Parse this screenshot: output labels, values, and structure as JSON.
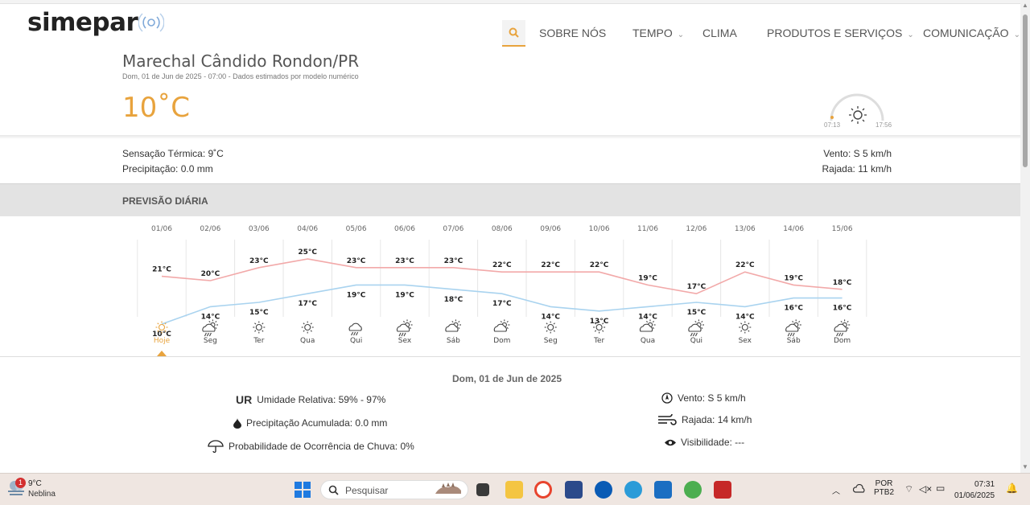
{
  "header": {
    "logo": "simepar",
    "nav": [
      {
        "label": "SOBRE NÓS",
        "dropdown": false
      },
      {
        "label": "TEMPO",
        "dropdown": true
      },
      {
        "label": "CLIMA",
        "dropdown": false
      },
      {
        "label": "PRODUTOS E SERVIÇOS",
        "dropdown": true
      },
      {
        "label": "COMUNICAÇÃO",
        "dropdown": true
      }
    ]
  },
  "current": {
    "city": "Marechal Cândido Rondon/PR",
    "subtitle": "Dom, 01 de Jun de 2025 - 07:00 - Dados estimados por modelo numérico",
    "temperature": "10˚C",
    "sunrise": "07:13",
    "sunset": "17:56",
    "feels_like": "Sensação Térmica: 9˚C",
    "precipitation": "Precipitação: 0.0 mm",
    "wind": "Vento: S 5 km/h",
    "gust": "Rajada: 11 km/h"
  },
  "forecast": {
    "section_title": "PREVISÃO DIÁRIA",
    "unit": "°C",
    "days": [
      {
        "date": "01/06",
        "max": 21,
        "min": 10,
        "day": "Hoje",
        "icon": "sun-icon"
      },
      {
        "date": "02/06",
        "max": 20,
        "min": 14,
        "day": "Seg",
        "icon": "sun-cloud-rain-icon"
      },
      {
        "date": "03/06",
        "max": 23,
        "min": 15,
        "day": "Ter",
        "icon": "sun-icon"
      },
      {
        "date": "04/06",
        "max": 25,
        "min": 17,
        "day": "Qua",
        "icon": "sun-icon"
      },
      {
        "date": "05/06",
        "max": 23,
        "min": 19,
        "day": "Qui",
        "icon": "cloud-rain-icon"
      },
      {
        "date": "06/06",
        "max": 23,
        "min": 19,
        "day": "Sex",
        "icon": "sun-cloud-rain-icon"
      },
      {
        "date": "07/06",
        "max": 23,
        "min": 18,
        "day": "Sáb",
        "icon": "sun-cloud-icon"
      },
      {
        "date": "08/06",
        "max": 22,
        "min": 17,
        "day": "Dom",
        "icon": "sun-cloud-icon"
      },
      {
        "date": "09/06",
        "max": 22,
        "min": 14,
        "day": "Seg",
        "icon": "sun-icon"
      },
      {
        "date": "10/06",
        "max": 22,
        "min": 13,
        "day": "Ter",
        "icon": "sun-icon"
      },
      {
        "date": "11/06",
        "max": 19,
        "min": 14,
        "day": "Qua",
        "icon": "sun-cloud-icon"
      },
      {
        "date": "12/06",
        "max": 17,
        "min": 15,
        "day": "Qui",
        "icon": "sun-cloud-rain-icon"
      },
      {
        "date": "13/06",
        "max": 22,
        "min": 14,
        "day": "Sex",
        "icon": "sun-icon"
      },
      {
        "date": "14/06",
        "max": 19,
        "min": 16,
        "day": "Sáb",
        "icon": "sun-cloud-rain-icon"
      },
      {
        "date": "15/06",
        "max": 18,
        "min": 16,
        "day": "Dom",
        "icon": "sun-cloud-rain-icon"
      }
    ],
    "colors": {
      "max_line": "#f2a9a9",
      "min_line": "#a9d3ef",
      "accent": "#e8a33d"
    }
  },
  "details": {
    "date": "Dom, 01 de Jun de 2025",
    "ur_abbr": "UR",
    "humidity": "Umidade Relativa: 59% - 97%",
    "precip_acc": "Precipitação Acumulada: 0.0 mm",
    "rain_prob": "Probabilidade de Ocorrência de Chuva: 0%",
    "wind": "Vento: S 5 km/h",
    "gust": "Rajada: 14 km/h",
    "visibility": "Visibilidade: ---"
  },
  "taskbar": {
    "weather_temp": "9°C",
    "weather_desc": "Neblina",
    "weather_badge": "1",
    "search_placeholder": "Pesquisar",
    "lang": "POR",
    "layout": "PTB2",
    "time": "07:31",
    "date": "01/06/2025"
  }
}
